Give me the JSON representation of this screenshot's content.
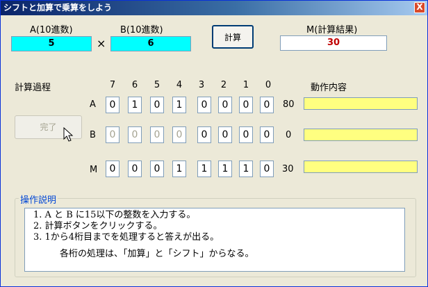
{
  "window": {
    "title": "シフトと加算で乗算をしよう",
    "close_label": "X"
  },
  "inputs": {
    "a_label": "A(10進数)",
    "a_value": "5",
    "times": "×",
    "b_label": "B(10進数)",
    "b_value": "6",
    "m_label": "M(計算結果)",
    "m_value": "30"
  },
  "calc_button": "計算",
  "process_label": "計算過程",
  "action_label": "動作内容",
  "done_button": "完了",
  "bit_headers": [
    "7",
    "6",
    "5",
    "4",
    "3",
    "2",
    "1",
    "0"
  ],
  "rows": [
    {
      "label": "A",
      "bits": [
        "0",
        "1",
        "0",
        "1",
        "0",
        "0",
        "0",
        "0"
      ],
      "decimal": "80"
    },
    {
      "label": "B",
      "bits": [
        "0",
        "0",
        "0",
        "0",
        "0",
        "0",
        "0",
        "0"
      ],
      "decimal": "0"
    },
    {
      "label": "M",
      "bits": [
        "0",
        "0",
        "0",
        "1",
        "1",
        "1",
        "1",
        "0"
      ],
      "decimal": "30"
    }
  ],
  "description": {
    "title": "操作説明",
    "lines": [
      "1. A と B に15以下の整数を入力する。",
      "2. 計算ボタンをクリックする。",
      "3. 1から4桁目までを処理すると答えが出る。",
      "各桁の処理は、「加算」と「シフト」からなる。"
    ]
  },
  "colors": {
    "cyan": "#00ffff",
    "yellow": "#ffff80",
    "result": "#c00000",
    "group_title": "#0046d5"
  }
}
